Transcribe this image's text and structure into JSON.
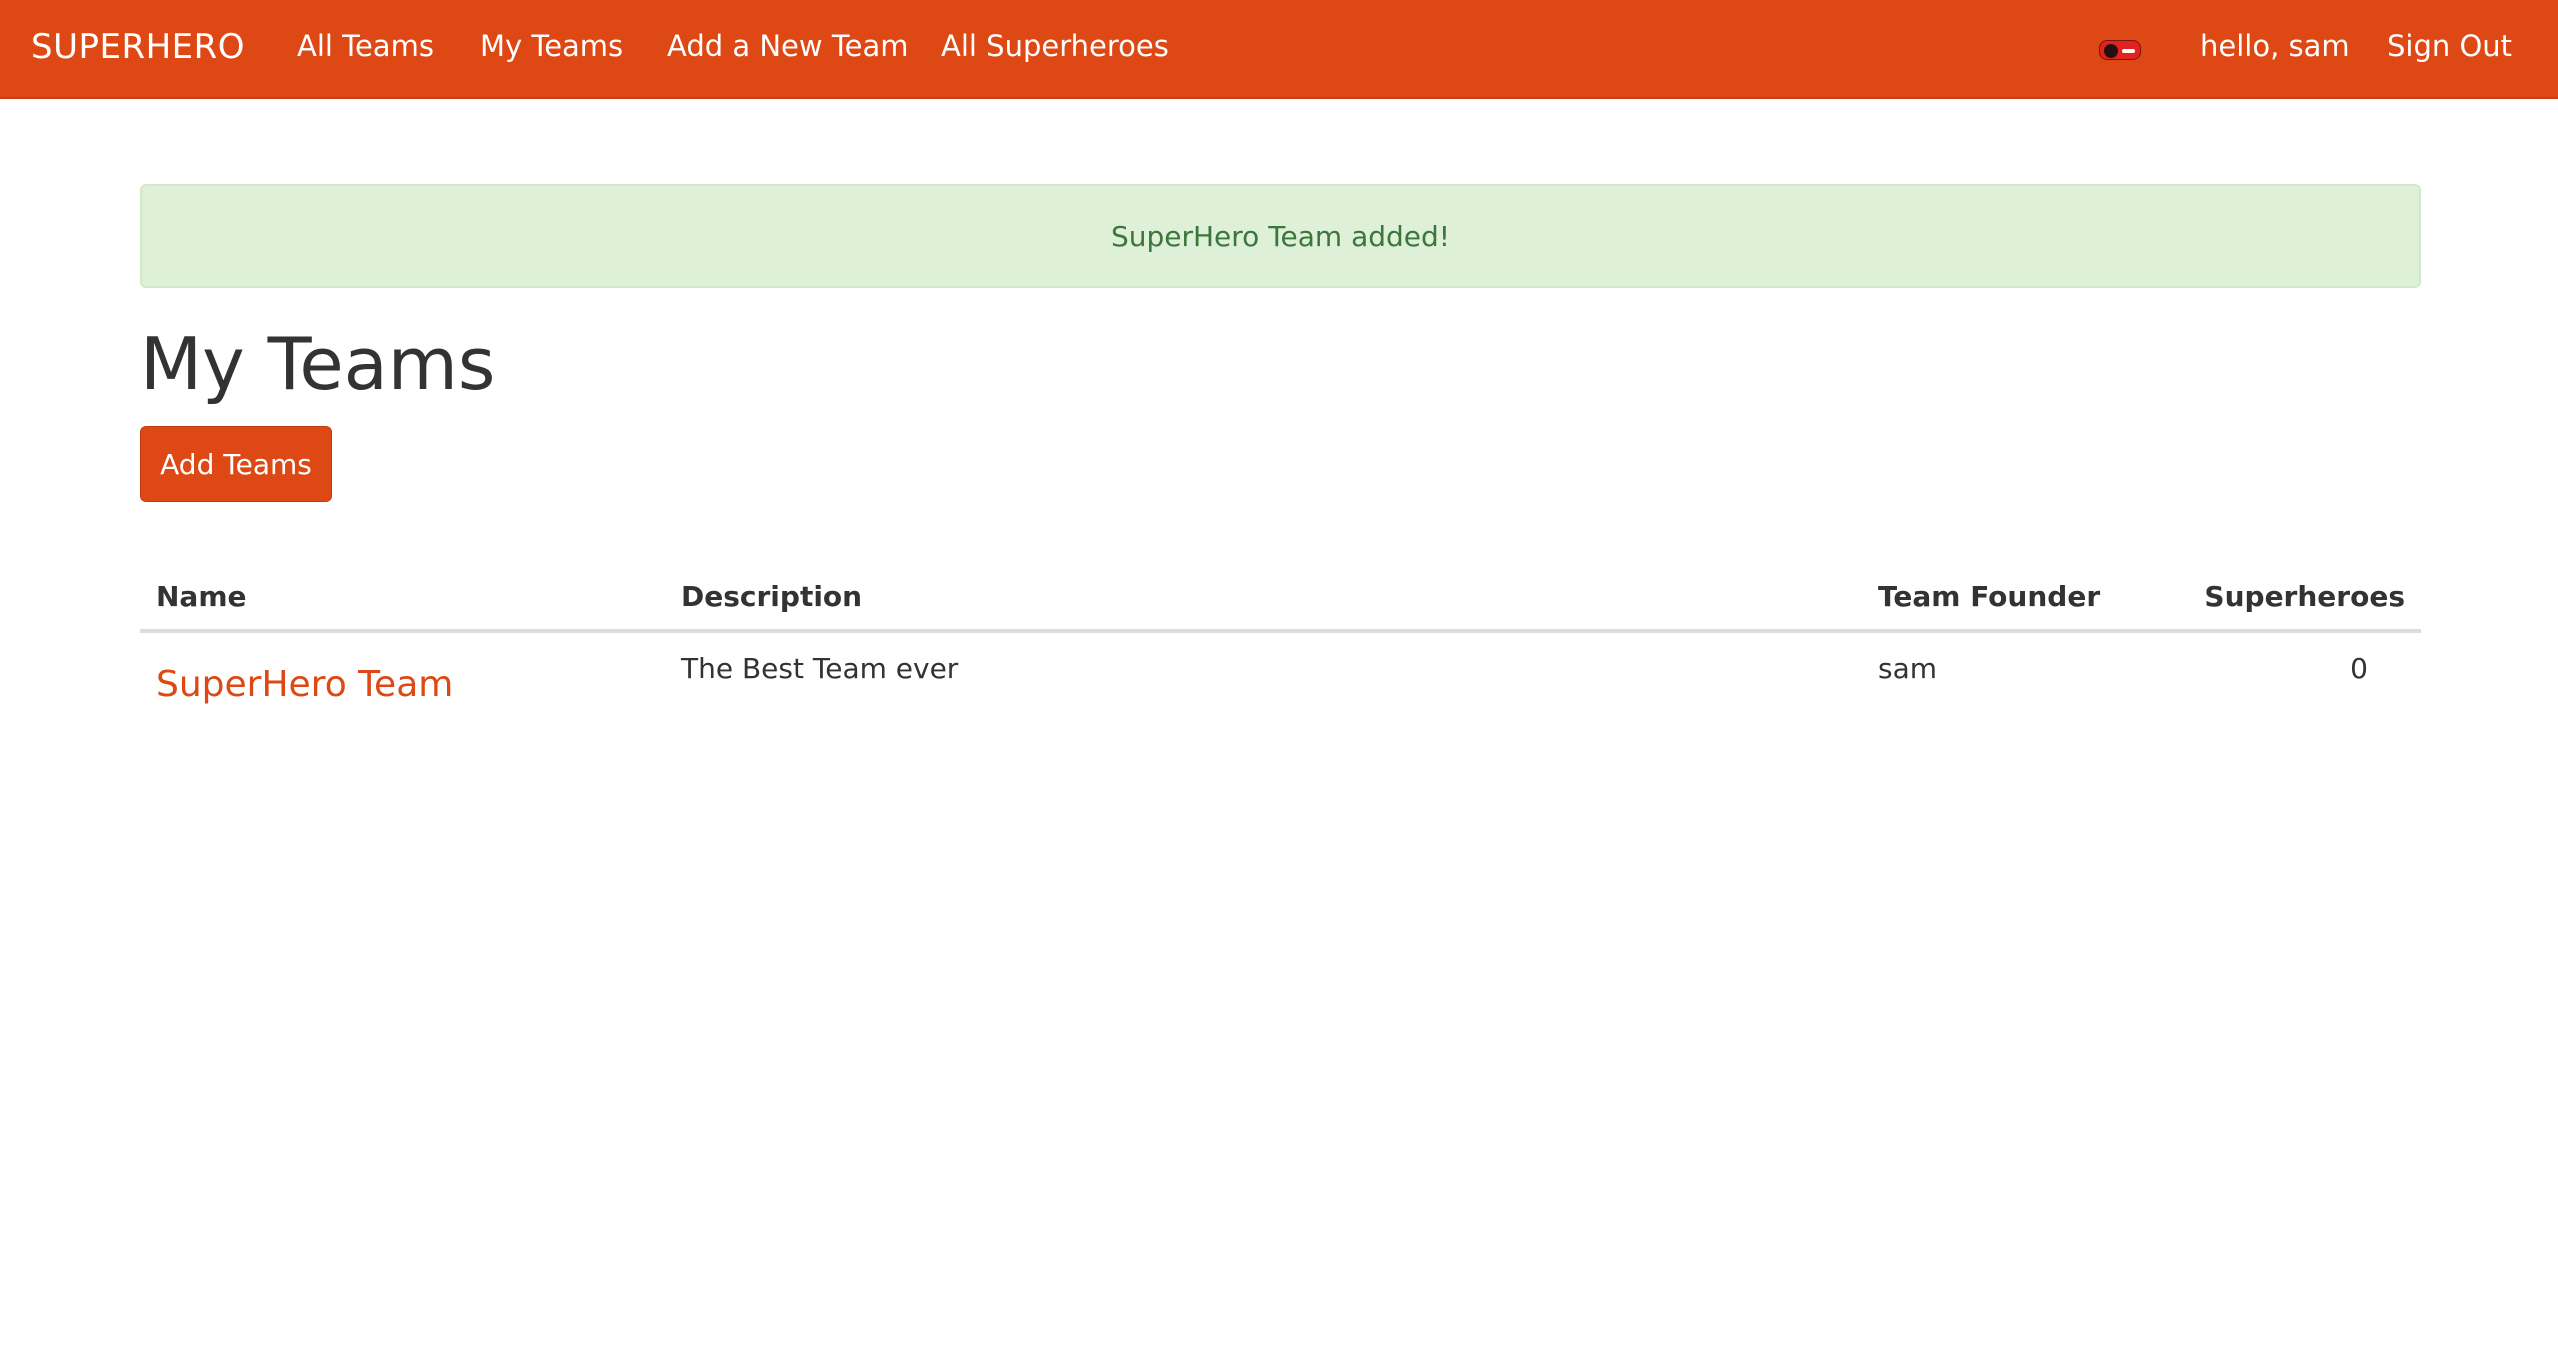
{
  "navbar": {
    "brand": "SUPERHERO",
    "links": [
      "All Teams",
      "My Teams",
      "Add a New Team",
      "All Superheroes"
    ],
    "greeting": "hello, sam",
    "signout": "Sign Out",
    "avatar_icon": "user-avatar-icon"
  },
  "alert": {
    "message": "SuperHero Team added!"
  },
  "page": {
    "title": "My Teams",
    "add_button": "Add Teams"
  },
  "table": {
    "headers": [
      "Name",
      "Description",
      "Team Founder",
      "Superheroes"
    ],
    "rows": [
      {
        "name": "SuperHero Team",
        "description": "The Best Team ever",
        "founder": "sam",
        "superheroes": "0"
      }
    ]
  },
  "colors": {
    "brand": "#dd4814",
    "success_bg": "#dff0d8",
    "success_text": "#3c763d"
  }
}
